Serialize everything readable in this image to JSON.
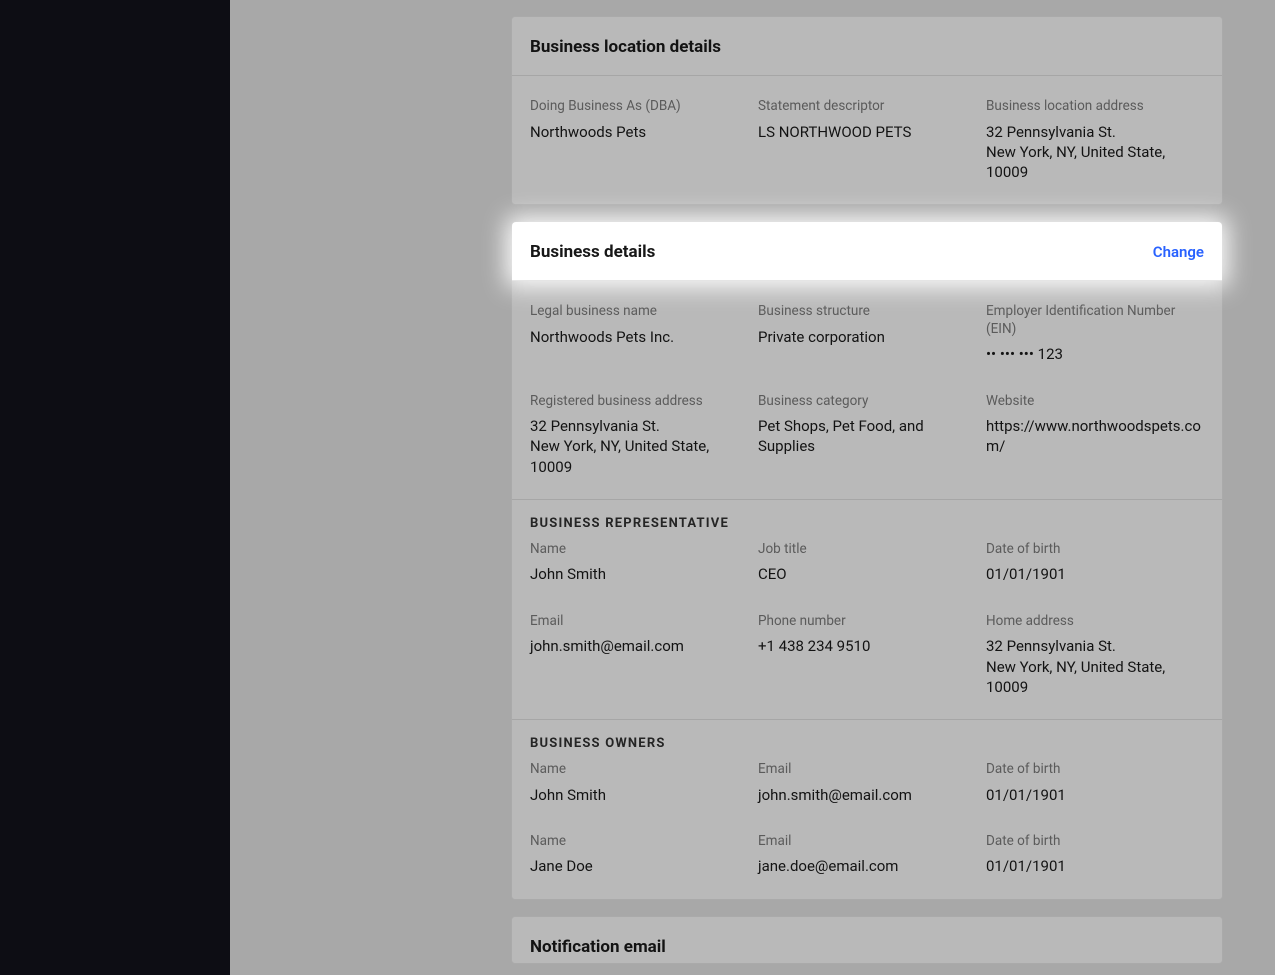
{
  "location": {
    "title": "Business location details",
    "dba_label": "Doing Business As (DBA)",
    "dba_value": "Northwoods Pets",
    "descriptor_label": "Statement descriptor",
    "descriptor_value": "LS NORTHWOOD PETS",
    "address_label": "Business location address",
    "address_line1": "32 Pennsylvania St.",
    "address_line2": "New York, NY, United State, 10009"
  },
  "business": {
    "title": "Business details",
    "change": "Change",
    "legal_name_label": "Legal business name",
    "legal_name_value": "Northwoods Pets Inc.",
    "structure_label": "Business structure",
    "structure_value": "Private corporation",
    "ein_label": "Employer Identification Number (EIN)",
    "ein_value": "•• ••• ••• 123",
    "reg_address_label": "Registered business address",
    "reg_address_line1": "32 Pennsylvania St.",
    "reg_address_line2": "New York, NY, United State, 10009",
    "category_label": "Business category",
    "category_value": "Pet Shops, Pet Food, and Supplies",
    "website_label": "Website",
    "website_value": "https://www.northwoodspets.com/"
  },
  "rep": {
    "title": "BUSINESS REPRESENTATIVE",
    "name_label": "Name",
    "name_value": "John Smith",
    "job_label": "Job title",
    "job_value": "CEO",
    "dob_label": "Date of birth",
    "dob_value": "01/01/1901",
    "email_label": "Email",
    "email_value": "john.smith@email.com",
    "phone_label": "Phone number",
    "phone_value": "+1 438 234 9510",
    "home_label": "Home address",
    "home_line1": "32 Pennsylvania St.",
    "home_line2": "New York, NY, United State, 10009"
  },
  "owners": {
    "title": "BUSINESS OWNERS",
    "name_label": "Name",
    "email_label": "Email",
    "dob_label": "Date of birth",
    "rows": [
      {
        "name": "John Smith",
        "email": "john.smith@email.com",
        "dob": "01/01/1901"
      },
      {
        "name": "Jane Doe",
        "email": "jane.doe@email.com",
        "dob": "01/01/1901"
      }
    ]
  },
  "notification": {
    "title": "Notification email"
  }
}
